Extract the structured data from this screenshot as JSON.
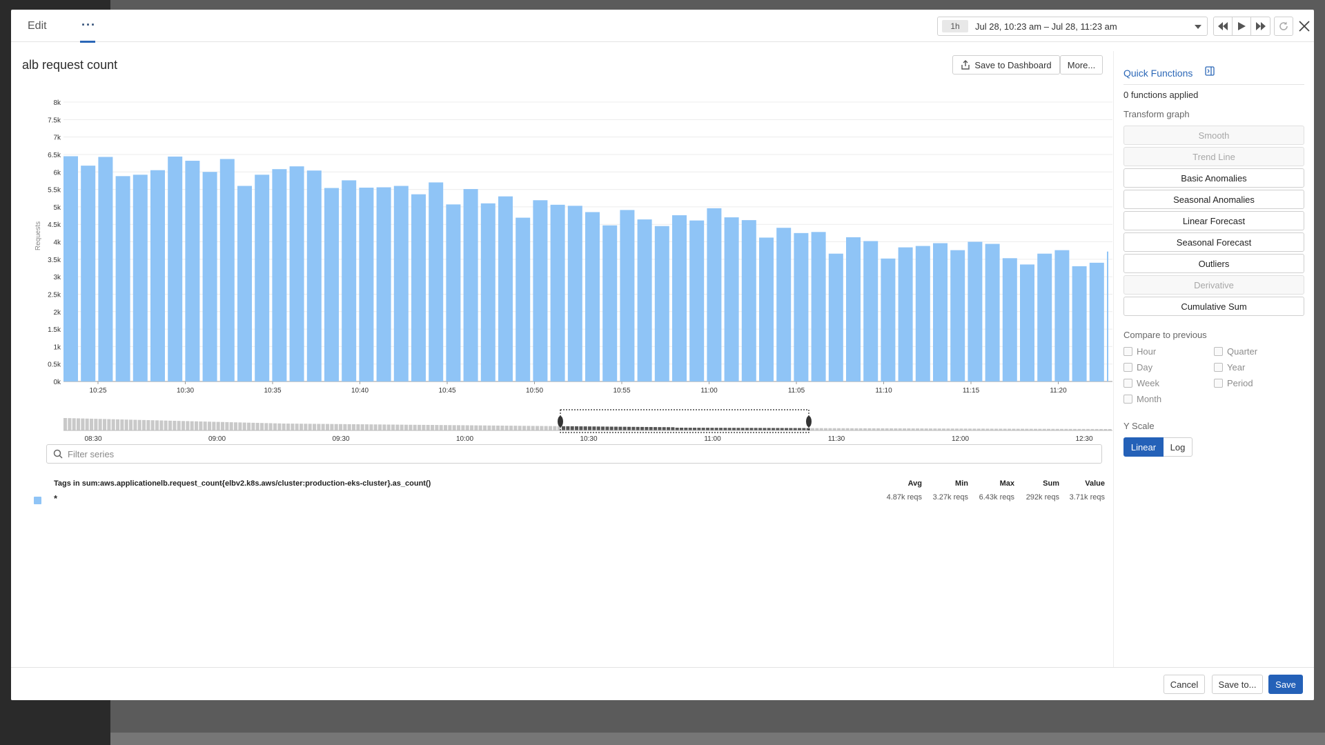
{
  "tabs": {
    "edit": "Edit",
    "more": "···"
  },
  "timepicker": {
    "preset": "1h",
    "range": "Jul 28, 10:23 am – Jul 28, 11:23 am"
  },
  "icons": {
    "back": "skip-back-icon",
    "play": "play-icon",
    "forward": "skip-forward-icon",
    "refresh": "refresh-icon",
    "close": "close-icon",
    "share": "share-icon",
    "search": "search-icon",
    "panel": "panel-icon"
  },
  "graph": {
    "title": "alb request count"
  },
  "toolbar": {
    "save_to_dashboard": "Save to Dashboard",
    "more": "More..."
  },
  "chart_data": {
    "type": "bar",
    "ylabel": "Requests",
    "ylim": [
      0,
      8000
    ],
    "yticks": [
      "0k",
      "0.5k",
      "1k",
      "1.5k",
      "2k",
      "2.5k",
      "3k",
      "3.5k",
      "4k",
      "4.5k",
      "5k",
      "5.5k",
      "6k",
      "6.5k",
      "7k",
      "7.5k",
      "8k"
    ],
    "xticks": [
      "10:25",
      "10:30",
      "10:35",
      "10:40",
      "10:45",
      "10:50",
      "10:55",
      "11:00",
      "11:05",
      "11:10",
      "11:15",
      "11:20"
    ],
    "values": [
      6450,
      6180,
      6430,
      5880,
      5920,
      6050,
      6440,
      6320,
      6000,
      6370,
      5600,
      5920,
      6080,
      6160,
      6040,
      5540,
      5760,
      5550,
      5560,
      5600,
      5360,
      5700,
      5070,
      5510,
      5100,
      5300,
      4690,
      5190,
      5060,
      5030,
      4850,
      4470,
      4910,
      4640,
      4450,
      4760,
      4610,
      4960,
      4700,
      4620,
      4120,
      4400,
      4250,
      4280,
      3660,
      4130,
      4020,
      3520,
      3840,
      3880,
      3960,
      3760,
      4000,
      3940,
      3530,
      3350,
      3660,
      3760,
      3300,
      3400,
      3720
    ],
    "series": [
      {
        "name": "*",
        "color": "#8fc4f6"
      }
    ],
    "grid": true,
    "color": "#8fc4f6"
  },
  "navigator": {
    "ticks": [
      "08:30",
      "09:00",
      "09:30",
      "10:00",
      "10:30",
      "11:00",
      "11:30",
      "12:00",
      "12:30"
    ]
  },
  "filter": {
    "placeholder": "Filter series"
  },
  "legend": {
    "header": "Tags in sum:aws.applicationelb.request_count{elbv2.k8s.aws/cluster:production-eks-cluster}.as_count()",
    "columns": [
      "Avg",
      "Min",
      "Max",
      "Sum",
      "Value"
    ],
    "series_label": "*",
    "values": [
      "4.87k reqs",
      "3.27k reqs",
      "6.43k reqs",
      "292k reqs",
      "3.71k reqs"
    ]
  },
  "side": {
    "quick_functions": "Quick Functions",
    "applied": "0 functions applied",
    "transform_label": "Transform graph",
    "functions": [
      {
        "label": "Smooth",
        "enabled": false
      },
      {
        "label": "Trend Line",
        "enabled": false
      },
      {
        "label": "Basic Anomalies",
        "enabled": true
      },
      {
        "label": "Seasonal Anomalies",
        "enabled": true
      },
      {
        "label": "Linear Forecast",
        "enabled": true
      },
      {
        "label": "Seasonal Forecast",
        "enabled": true
      },
      {
        "label": "Outliers",
        "enabled": true
      },
      {
        "label": "Derivative",
        "enabled": false
      },
      {
        "label": "Cumulative Sum",
        "enabled": true
      }
    ],
    "compare_label": "Compare to previous",
    "compare": [
      "Hour",
      "Quarter",
      "Day",
      "Year",
      "Week",
      "Period",
      "Month"
    ],
    "yscale_label": "Y Scale",
    "yscale": {
      "linear": "Linear",
      "log": "Log",
      "selected": "Linear"
    }
  },
  "footer": {
    "cancel": "Cancel",
    "save_to": "Save to...",
    "save": "Save"
  },
  "colors": {
    "accent": "#2461b8",
    "bar": "#8fc4f6",
    "link": "#2b67b7"
  }
}
